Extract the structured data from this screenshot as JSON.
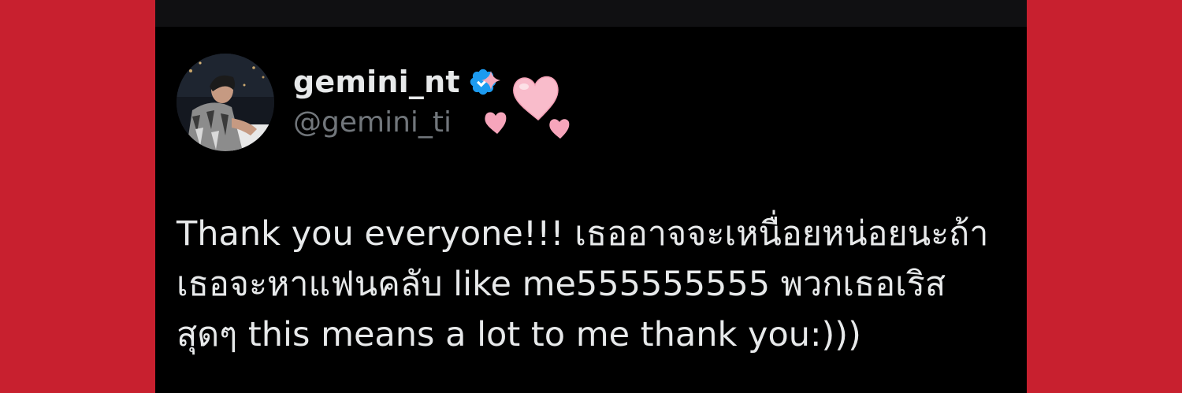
{
  "tweet": {
    "display_name": "gemini_nt",
    "handle": "@gemini_ti",
    "text": "Thank you everyone!!! เธออาจจะเหนื่อยหน่อยนะถ้า\nเธอจะหาแฟนคลับ like me555555555 พวกเธอเริส\nสุดๆ this means a lot to me thank you:)))"
  },
  "icons": {
    "verified": "verified-badge-icon",
    "sparkle": "sparkle-icon",
    "hearts": "hearts-sticker"
  },
  "colors": {
    "background": "#c8202f",
    "card": "#000000",
    "text": "#e7e9ea",
    "muted": "#71767b",
    "verified": "#1d9bf0",
    "heart": "#f7b3c3"
  }
}
